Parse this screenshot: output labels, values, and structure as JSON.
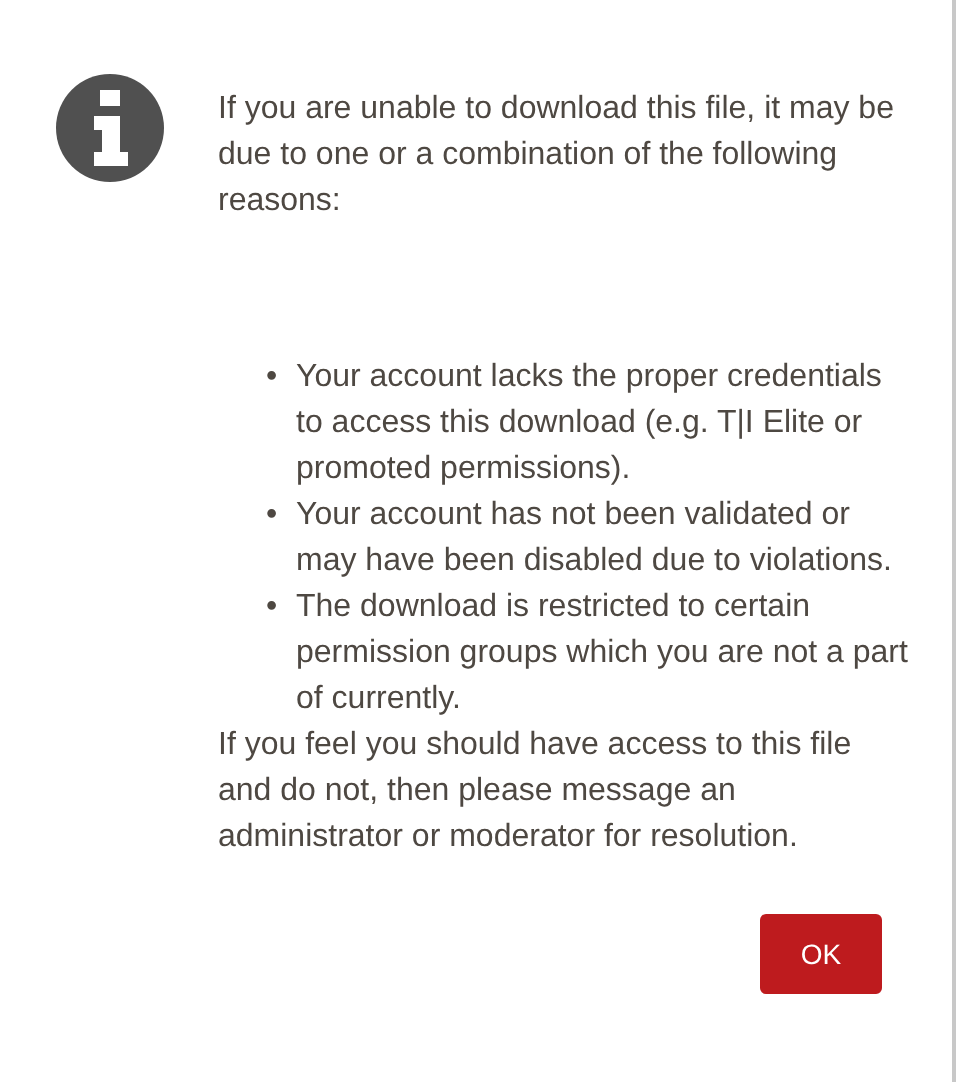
{
  "message": {
    "intro": "If you are unable to download this file, it may be due to one or a combination of the following reasons:",
    "reasons": [
      {
        "marker": "•",
        "text": "Your account lacks the proper credentials to access this download (e.g. T|I Elite or promoted permissions)."
      },
      {
        "marker": "•",
        "text": "Your account has not been validated or may have been disabled due to violations."
      },
      {
        "marker": "•",
        "text": "The download is restricted to certain permission groups which you are not a part of currently."
      }
    ],
    "closing": "If you feel you should have access to this file and do not, then please message an administrator or moderator for resolution."
  },
  "buttons": [
    "OK"
  ]
}
